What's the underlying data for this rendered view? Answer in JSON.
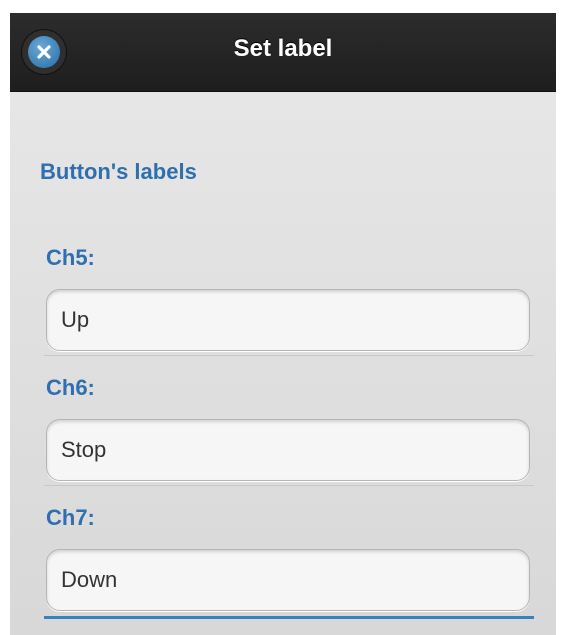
{
  "dialog": {
    "title": "Set label"
  },
  "section": {
    "heading": "Button's labels"
  },
  "fields": [
    {
      "label": "Ch5:",
      "value": "Up"
    },
    {
      "label": "Ch6:",
      "value": "Stop"
    },
    {
      "label": "Ch7:",
      "value": "Down"
    }
  ],
  "icons": {
    "close": "close-icon"
  },
  "colors": {
    "header_bg": "#1e1e1e",
    "accent_blue": "#2f6fb0",
    "close_button": "#3a7fb5",
    "content_bg": "#dcdcdc"
  }
}
